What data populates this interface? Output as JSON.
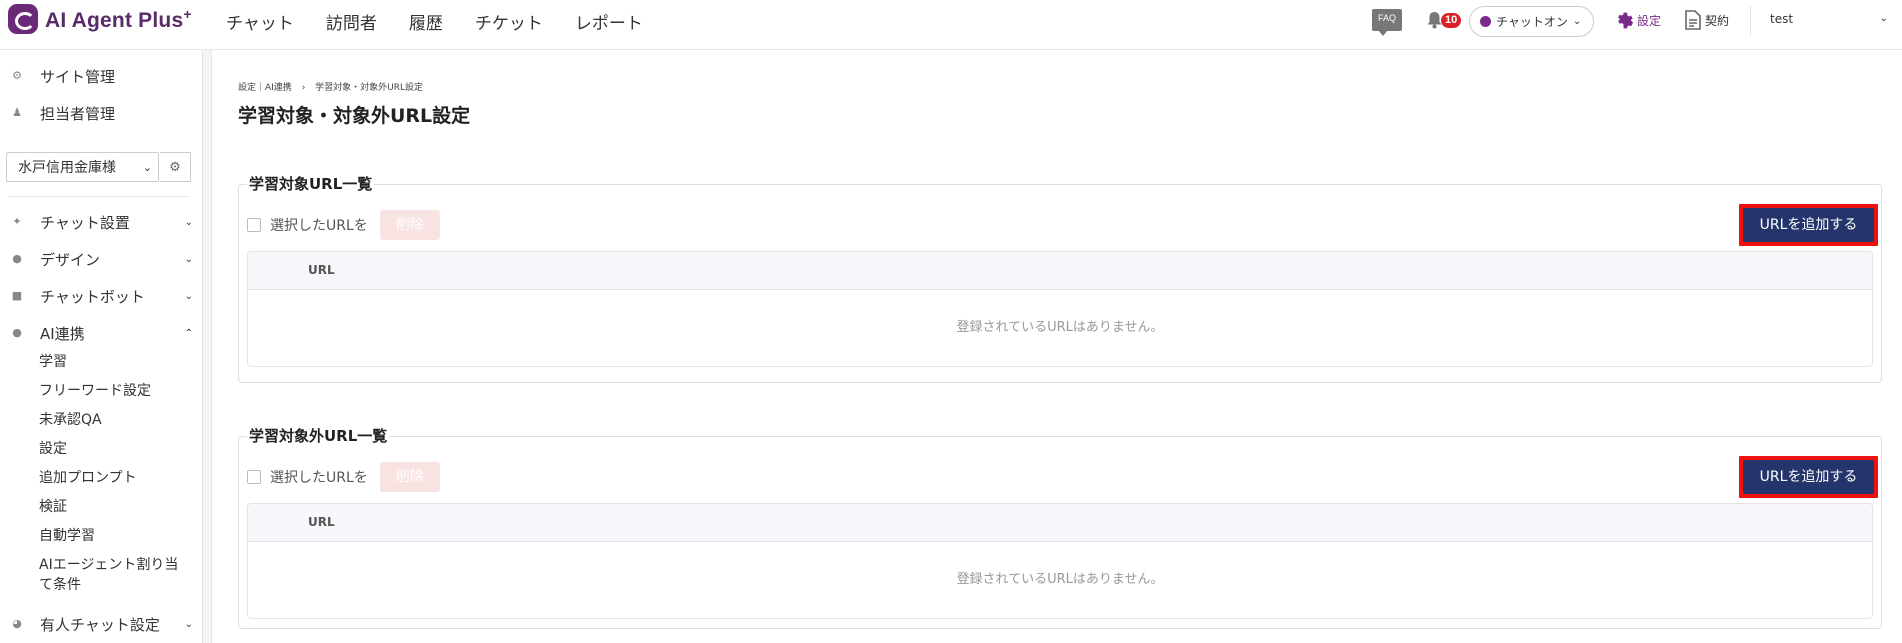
{
  "header": {
    "logo_text": "AI Agent Plus",
    "logo_plus": "+",
    "nav": [
      "チャット",
      "訪問者",
      "履歴",
      "チケット",
      "レポート"
    ],
    "faq_label": "FAQ",
    "notification_count": "10",
    "chat_status": "チャットオン",
    "settings_label": "設定",
    "contract_label": "契約",
    "user_name": "test",
    "accent_color": "#7a2a8a"
  },
  "sidebar": {
    "top_items": [
      {
        "label": "サイト管理",
        "icon": "gear-icon"
      },
      {
        "label": "担当者管理",
        "icon": "users-icon"
      }
    ],
    "site_select": "水戸信用金庫様",
    "menu": [
      {
        "label": "チャット設置",
        "icon": "tools-icon"
      },
      {
        "label": "デザイン",
        "icon": "palette-icon"
      },
      {
        "label": "チャットボット",
        "icon": "chat-icon"
      },
      {
        "label": "AI連携",
        "icon": "ai-icon"
      }
    ],
    "ai_sub": [
      "学習",
      "フリーワード設定",
      "未承認QA",
      "設定",
      "追加プロンプト",
      "検証",
      "自動学習",
      "AIエージェント割り当て条件"
    ],
    "bottom_item": {
      "label": "有人チャット設定",
      "icon": "headset-icon"
    }
  },
  "main": {
    "breadcrumb_1": "設定｜AI連携",
    "breadcrumb_sep": "›",
    "breadcrumb_2": "学習対象・対象外URL設定",
    "title": "学習対象・対象外URL設定",
    "panels": [
      {
        "legend": "学習対象URL一覧",
        "select_label": "選択したURLを",
        "delete_label": "削除",
        "add_label": "URLを追加する",
        "column": "URL",
        "empty": "登録されているURLはありません。"
      },
      {
        "legend": "学習対象外URL一覧",
        "select_label": "選択したURLを",
        "delete_label": "削除",
        "add_label": "URLを追加する",
        "column": "URL",
        "empty": "登録されているURLはありません。"
      }
    ]
  }
}
